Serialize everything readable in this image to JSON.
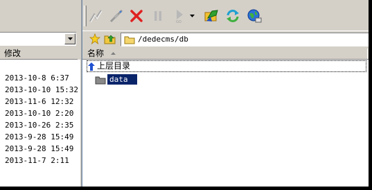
{
  "left_pane": {
    "header_label": "修改",
    "dropdown_value": "",
    "dates": [
      "2013-10-8 6:37",
      "2013-10-10 15:32",
      "2013-11-6 12:32",
      "2013-10-10 2:20",
      "2013-10-26 2:35",
      "2013-9-28 15:49",
      "2013-9-28 15:49",
      "2013-11-7 2:11"
    ]
  },
  "toolbar": {
    "buttons": [
      {
        "name": "connect-icon",
        "enabled": false
      },
      {
        "name": "disconnect-icon",
        "enabled": false
      },
      {
        "name": "stop-icon",
        "enabled": true
      },
      {
        "name": "pause-icon",
        "enabled": false
      },
      {
        "name": "go-icon",
        "enabled": false,
        "label": "GO"
      },
      {
        "name": "dropdown-arrow-icon",
        "enabled": true
      },
      {
        "name": "transfer-icon",
        "enabled": true
      },
      {
        "name": "refresh-icon",
        "enabled": true
      },
      {
        "name": "globe-icon",
        "enabled": true
      }
    ]
  },
  "address_bar": {
    "path": "/dedecms/db"
  },
  "file_list": {
    "column_name": "名称",
    "parent_dir_label": "上层目录",
    "items": [
      {
        "name": "data",
        "type": "folder",
        "selected": true
      }
    ]
  },
  "colors": {
    "selection": "#0a246a",
    "chrome": "#d4d0c8",
    "stop_red": "#e02020",
    "folder_yellow": "#f5d76e"
  }
}
